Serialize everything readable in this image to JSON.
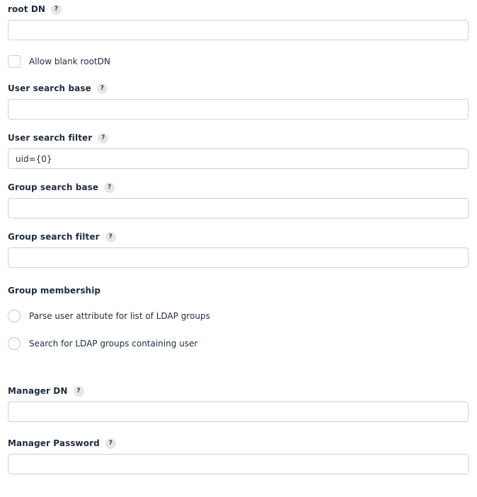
{
  "form": {
    "name": "ldap-directory-settings",
    "help_icon_glyph": "?",
    "fields": {
      "root_dn": {
        "label": "root DN",
        "has_help": true,
        "value": "",
        "placeholder": ""
      },
      "allow_blank_rootdn": {
        "label": "Allow blank rootDN",
        "checked": false
      },
      "user_search_base": {
        "label": "User search base",
        "has_help": true,
        "value": "",
        "placeholder": ""
      },
      "user_search_filter": {
        "label": "User search filter",
        "has_help": true,
        "value": "uid={0}",
        "placeholder": ""
      },
      "group_search_base": {
        "label": "Group search base",
        "has_help": true,
        "value": "",
        "placeholder": ""
      },
      "group_search_filter": {
        "label": "Group search filter",
        "has_help": true,
        "value": "",
        "placeholder": ""
      },
      "group_membership": {
        "label": "Group membership",
        "has_help": false,
        "options": [
          {
            "label": "Parse user attribute for list of LDAP groups",
            "selected": false
          },
          {
            "label": "Search for LDAP groups containing user",
            "selected": false
          }
        ]
      },
      "manager_dn": {
        "label": "Manager DN",
        "has_help": true,
        "value": "",
        "placeholder": ""
      },
      "manager_password": {
        "label": "Manager Password",
        "has_help": true,
        "value": "",
        "placeholder": ""
      }
    }
  },
  "colors": {
    "background": "#ffffff",
    "label_text": "#1f2b3d",
    "input_border": "#ccd2d9",
    "help_badge_bg": "#e6e6e6",
    "control_border": "#c9ced6"
  }
}
